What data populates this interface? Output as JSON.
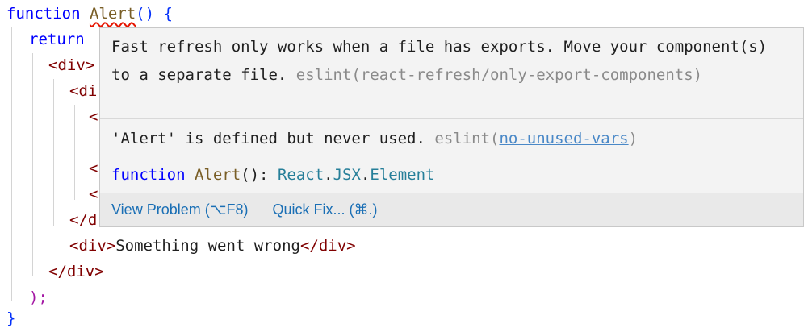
{
  "code": {
    "line1_kw": "function",
    "line1_fn": "Alert",
    "line1_rest": "() {",
    "line2_kw": "return",
    "line3": "<div>",
    "line4": "<di",
    "line5": "<",
    "line7": "<",
    "line8": "<",
    "line9": "</d",
    "line10_open": "<div>",
    "line10_text": "Something went wrong",
    "line10_close": "</div>",
    "line11": "</div>",
    "line12": ");",
    "line13": "}"
  },
  "hover": {
    "message1_main": "Fast refresh only works when a file has exports. Move your component(s) to a separate file.",
    "message1_source": "eslint(react-refresh/only-export-components)",
    "message2_main": "'Alert' is defined but never used.",
    "message2_source_prefix": "eslint(",
    "message2_source_link": "no-unused-vars",
    "message2_source_suffix": ")",
    "signature_kw": "function",
    "signature_name": "Alert",
    "signature_punc": "():",
    "signature_type_ns1": "React",
    "signature_type_ns2": "JSX",
    "signature_type_name": "Element",
    "actions": {
      "view_problem": "View Problem (⌥F8)",
      "quick_fix": "Quick Fix... (⌘.)"
    }
  }
}
